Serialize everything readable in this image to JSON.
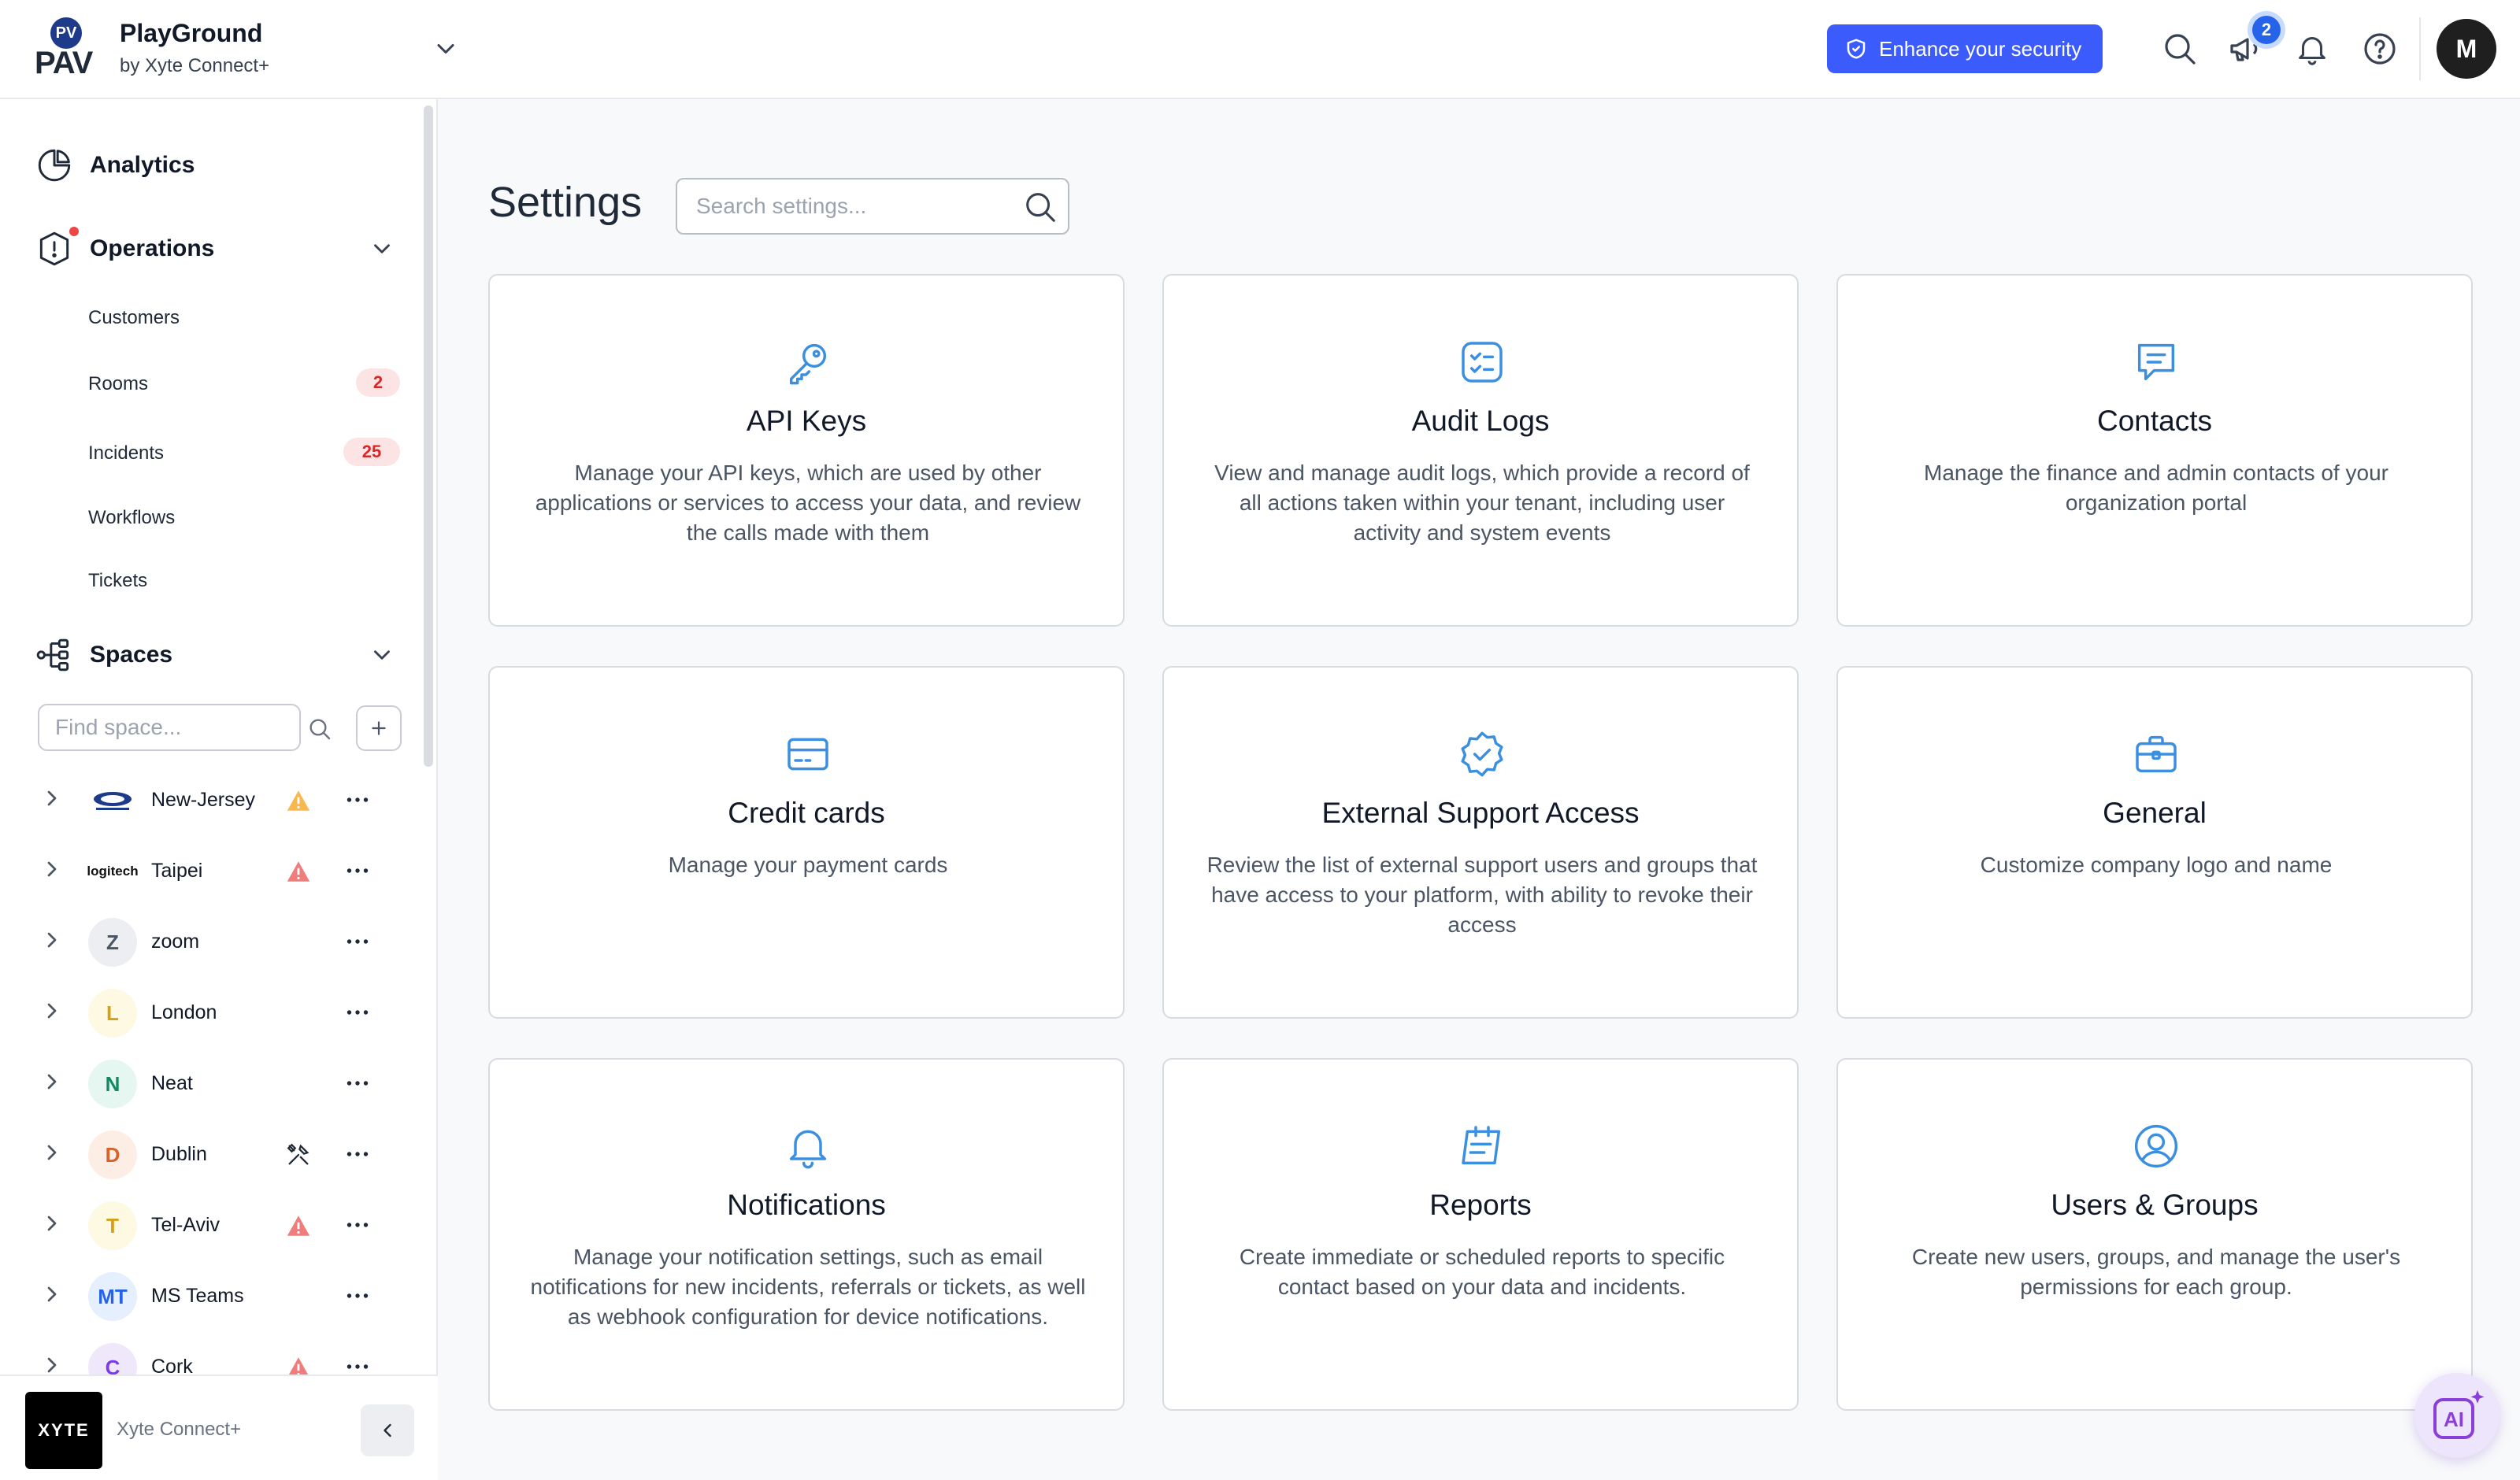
{
  "header": {
    "logo_mark": "PV",
    "logo_text": "PAV",
    "brand_name": "PlayGround",
    "brand_sub": "by Xyte Connect+",
    "security_button": "Enhance your security",
    "announcements_count": "2",
    "avatar_initial": "M"
  },
  "sidebar": {
    "analytics": "Analytics",
    "operations": "Operations",
    "operations_items": [
      {
        "label": "Customers",
        "count": ""
      },
      {
        "label": "Rooms",
        "count": "2"
      },
      {
        "label": "Incidents",
        "count": "25"
      },
      {
        "label": "Workflows",
        "count": ""
      },
      {
        "label": "Tickets",
        "count": ""
      }
    ],
    "spaces": "Spaces",
    "find_space_placeholder": "Find space...",
    "space_list": [
      {
        "name": "New-Jersey",
        "logo": "",
        "status": "warning-icon"
      },
      {
        "name": "Taipei",
        "logo": "logitech",
        "status": "alert-icon"
      },
      {
        "name": "zoom",
        "logo": "Z",
        "status": ""
      },
      {
        "name": "London",
        "logo": "L",
        "status": ""
      },
      {
        "name": "Neat",
        "logo": "N",
        "status": ""
      },
      {
        "name": "Dublin",
        "logo": "D",
        "status": "tools-icon"
      },
      {
        "name": "Tel-Aviv",
        "logo": "T",
        "status": "alert-icon"
      },
      {
        "name": "MS Teams",
        "logo": "MT",
        "status": ""
      },
      {
        "name": "Cork",
        "logo": "C",
        "status": "alert-icon"
      }
    ],
    "footer": {
      "logo_text": "XYTE",
      "name": "Xyte Connect+"
    }
  },
  "main": {
    "title": "Settings",
    "search_placeholder": "Search settings...",
    "cards": [
      {
        "title": "API Keys",
        "desc": "Manage your API keys, which are used by other applications or services to access your data, and review the calls made with them",
        "icon": "key-icon"
      },
      {
        "title": "Audit Logs",
        "desc": "View and manage audit logs, which provide a record of all actions taken within your tenant, including user activity and system events",
        "icon": "checklist-icon"
      },
      {
        "title": "Contacts",
        "desc": "Manage the finance and admin contacts of your organization portal",
        "icon": "message-icon"
      },
      {
        "title": "Credit cards",
        "desc": "Manage your payment cards",
        "icon": "credit-card-icon"
      },
      {
        "title": "External Support Access",
        "desc": "Review the list of external support users and groups that have access to your platform, with ability to revoke their access",
        "icon": "verified-badge-icon"
      },
      {
        "title": "General",
        "desc": "Customize company logo and name",
        "icon": "briefcase-icon"
      },
      {
        "title": "Notifications",
        "desc": "Manage your notification settings, such as email notifications for new incidents, referrals or tickets, as well as webhook configuration for device notifications.",
        "icon": "bell-icon"
      },
      {
        "title": "Reports",
        "desc": "Create immediate or scheduled reports to specific contact based on your data and incidents.",
        "icon": "report-icon"
      },
      {
        "title": "Users & Groups",
        "desc": "Create new users, groups, and manage the user's permissions for each group.",
        "icon": "user-circle-icon"
      }
    ]
  },
  "ai_button": "AI",
  "colors": {
    "accent": "#3b5bfd",
    "icon_blue": "#3b8fe0",
    "badge_red": "#dc2626",
    "warning": "#f59e0b",
    "alert": "#ef6b6b"
  }
}
